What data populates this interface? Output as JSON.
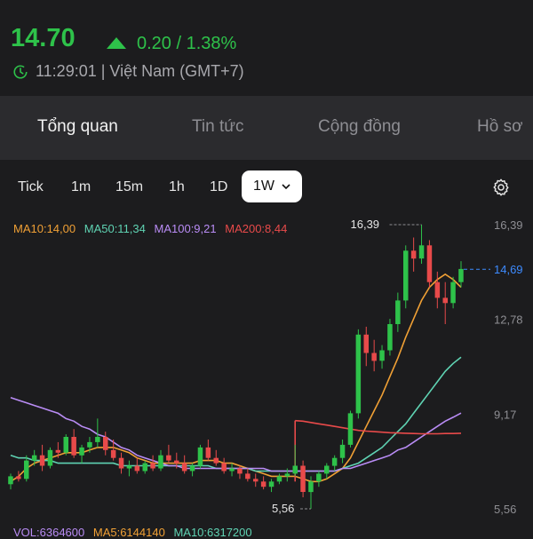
{
  "quote": {
    "price": "14.70",
    "change": "0.20 / 1.38%",
    "time": "11:29:01 | Việt Nam (GMT+7)",
    "up_color": "#2ec24a",
    "down_color": "#e84a4a"
  },
  "tabs": [
    {
      "label": "Tổng quan",
      "active": true
    },
    {
      "label": "Tin tức",
      "active": false
    },
    {
      "label": "Cộng đồng",
      "active": false
    },
    {
      "label": "Hồ sơ",
      "active": false
    }
  ],
  "timeframes": [
    "Tick",
    "1m",
    "15m",
    "1h",
    "1D"
  ],
  "selected_timeframe": "1W",
  "icons": {
    "settings": "gear-icon",
    "clock": "clock-icon",
    "dropdown": "chevron-down-icon",
    "trend": "triangle-up-icon"
  },
  "ma_legend": [
    {
      "label": "MA10:14,00",
      "color": "#f0a035"
    },
    {
      "label": "MA50:11,34",
      "color": "#5fd3b3"
    },
    {
      "label": "MA100:9,21",
      "color": "#b98cf5"
    },
    {
      "label": "MA200:8,44",
      "color": "#e84a4a"
    }
  ],
  "vol_legend": [
    {
      "label": "VOL:6364600",
      "color": "#b98cf5"
    },
    {
      "label": "MA5:6144140",
      "color": "#f0a035"
    },
    {
      "label": "MA10:6317200",
      "color": "#5fd3b3"
    }
  ],
  "chart_data": {
    "type": "candlestick",
    "y_ticks": [
      "16,39",
      "14,69",
      "12,78",
      "9,17",
      "5,56"
    ],
    "ylim": [
      5.56,
      16.39
    ],
    "current_price": 14.69,
    "high_label": "16,39",
    "low_label": "5,56",
    "candles": [
      [
        6.5,
        6.9,
        6.3,
        6.8
      ],
      [
        6.8,
        7.0,
        6.6,
        6.7
      ],
      [
        6.7,
        7.6,
        6.6,
        7.4
      ],
      [
        7.4,
        7.8,
        7.2,
        7.6
      ],
      [
        7.6,
        8.0,
        7.0,
        7.2
      ],
      [
        7.2,
        7.9,
        7.1,
        7.8
      ],
      [
        7.8,
        8.1,
        7.5,
        7.7
      ],
      [
        7.7,
        8.4,
        7.6,
        8.3
      ],
      [
        8.3,
        8.6,
        7.5,
        7.6
      ],
      [
        7.6,
        8.0,
        7.3,
        7.9
      ],
      [
        7.9,
        8.3,
        7.7,
        8.1
      ],
      [
        8.1,
        9.0,
        7.9,
        8.3
      ],
      [
        8.3,
        8.5,
        7.6,
        7.8
      ],
      [
        7.8,
        8.2,
        7.4,
        7.5
      ],
      [
        7.5,
        7.7,
        6.9,
        7.1
      ],
      [
        7.1,
        7.4,
        6.8,
        7.2
      ],
      [
        7.2,
        7.5,
        6.9,
        7.0
      ],
      [
        7.0,
        7.4,
        6.9,
        7.3
      ],
      [
        7.3,
        7.6,
        7.0,
        7.1
      ],
      [
        7.1,
        7.8,
        7.0,
        7.6
      ],
      [
        7.6,
        8.0,
        7.3,
        7.4
      ],
      [
        7.4,
        7.7,
        7.1,
        7.3
      ],
      [
        7.3,
        7.6,
        6.9,
        7.0
      ],
      [
        7.0,
        7.3,
        6.8,
        7.2
      ],
      [
        7.2,
        8.0,
        7.1,
        7.9
      ],
      [
        7.9,
        8.2,
        7.4,
        7.5
      ],
      [
        7.5,
        7.8,
        7.2,
        7.3
      ],
      [
        7.3,
        7.5,
        6.9,
        7.0
      ],
      [
        7.0,
        7.3,
        6.8,
        7.1
      ],
      [
        7.1,
        7.2,
        6.7,
        6.9
      ],
      [
        6.9,
        7.1,
        6.6,
        6.7
      ],
      [
        6.7,
        6.9,
        6.4,
        6.6
      ],
      [
        6.6,
        6.8,
        6.3,
        6.4
      ],
      [
        6.4,
        6.7,
        6.2,
        6.6
      ],
      [
        6.6,
        6.9,
        6.5,
        6.8
      ],
      [
        6.8,
        7.1,
        6.6,
        6.9
      ],
      [
        6.9,
        8.0,
        6.8,
        7.2
      ],
      [
        7.2,
        7.4,
        6.0,
        6.2
      ],
      [
        6.2,
        6.8,
        5.56,
        6.6
      ],
      [
        6.6,
        7.0,
        6.4,
        6.9
      ],
      [
        6.9,
        7.3,
        6.7,
        7.2
      ],
      [
        7.2,
        7.6,
        7.0,
        7.5
      ],
      [
        7.5,
        8.2,
        7.3,
        8.0
      ],
      [
        8.0,
        9.3,
        7.9,
        9.2
      ],
      [
        9.2,
        12.4,
        9.0,
        12.2
      ],
      [
        12.2,
        12.5,
        11.0,
        11.5
      ],
      [
        11.5,
        12.0,
        10.8,
        11.2
      ],
      [
        11.2,
        11.8,
        10.9,
        11.6
      ],
      [
        11.6,
        12.8,
        11.4,
        12.6
      ],
      [
        12.6,
        13.8,
        12.3,
        13.5
      ],
      [
        13.5,
        15.6,
        13.2,
        15.4
      ],
      [
        15.4,
        15.9,
        14.6,
        15.1
      ],
      [
        15.1,
        16.39,
        14.9,
        15.6
      ],
      [
        15.6,
        15.8,
        14.0,
        14.2
      ],
      [
        14.2,
        14.6,
        13.2,
        13.6
      ],
      [
        13.6,
        14.2,
        12.6,
        13.4
      ],
      [
        13.4,
        14.4,
        13.2,
        14.2
      ],
      [
        14.2,
        15.0,
        14.0,
        14.7
      ]
    ],
    "series": [
      {
        "name": "MA10",
        "color": "#f0a035",
        "values": [
          6.6,
          6.8,
          7.1,
          7.3,
          7.4,
          7.5,
          7.6,
          7.7,
          7.7,
          7.7,
          7.8,
          7.9,
          7.9,
          7.9,
          7.8,
          7.7,
          7.5,
          7.4,
          7.3,
          7.3,
          7.3,
          7.3,
          7.3,
          7.3,
          7.4,
          7.4,
          7.4,
          7.3,
          7.3,
          7.2,
          7.1,
          7.0,
          6.9,
          6.8,
          6.8,
          6.8,
          6.8,
          6.7,
          6.6,
          6.6,
          6.7,
          6.9,
          7.1,
          7.5,
          8.1,
          8.7,
          9.3,
          9.9,
          10.6,
          11.3,
          12.1,
          12.8,
          13.5,
          14.0,
          14.3,
          14.5,
          14.3,
          14.0
        ]
      },
      {
        "name": "MA50",
        "color": "#5fd3b3",
        "values": [
          7.6,
          7.5,
          7.5,
          7.4,
          7.4,
          7.4,
          7.3,
          7.3,
          7.3,
          7.3,
          7.3,
          7.3,
          7.3,
          7.3,
          7.2,
          7.2,
          7.2,
          7.2,
          7.2,
          7.2,
          7.2,
          7.2,
          7.2,
          7.2,
          7.2,
          7.2,
          7.1,
          7.1,
          7.1,
          7.1,
          7.1,
          7.0,
          7.0,
          7.0,
          7.0,
          7.0,
          7.0,
          7.0,
          7.0,
          7.0,
          7.0,
          7.0,
          7.1,
          7.2,
          7.3,
          7.5,
          7.7,
          7.9,
          8.2,
          8.5,
          8.8,
          9.2,
          9.6,
          10.0,
          10.4,
          10.8,
          11.1,
          11.34
        ]
      },
      {
        "name": "MA100",
        "color": "#b98cf5",
        "values": [
          9.8,
          9.7,
          9.6,
          9.5,
          9.4,
          9.3,
          9.2,
          9.0,
          8.9,
          8.7,
          8.6,
          8.4,
          8.3,
          8.1,
          7.9,
          7.8,
          7.6,
          7.5,
          7.4,
          7.3,
          7.2,
          7.2,
          7.1,
          7.1,
          7.1,
          7.1,
          7.1,
          7.1,
          7.1,
          7.1,
          7.1,
          7.1,
          7.1,
          7.0,
          7.0,
          7.0,
          7.0,
          7.0,
          7.0,
          7.0,
          7.0,
          7.0,
          7.1,
          7.1,
          7.2,
          7.3,
          7.4,
          7.5,
          7.6,
          7.8,
          7.9,
          8.1,
          8.3,
          8.5,
          8.7,
          8.9,
          9.05,
          9.21
        ]
      },
      {
        "name": "MA200",
        "color": "#e84a4a",
        "values": [
          null,
          null,
          null,
          null,
          null,
          null,
          null,
          null,
          null,
          null,
          null,
          null,
          null,
          null,
          null,
          null,
          null,
          null,
          null,
          null,
          null,
          null,
          null,
          null,
          null,
          null,
          null,
          null,
          null,
          null,
          null,
          null,
          null,
          null,
          null,
          null,
          8.92,
          8.9,
          8.85,
          8.8,
          8.75,
          8.7,
          8.65,
          8.6,
          8.55,
          8.52,
          8.5,
          8.48,
          8.46,
          8.45,
          8.44,
          8.43,
          8.42,
          8.42,
          8.42,
          8.43,
          8.43,
          8.44
        ]
      }
    ]
  }
}
